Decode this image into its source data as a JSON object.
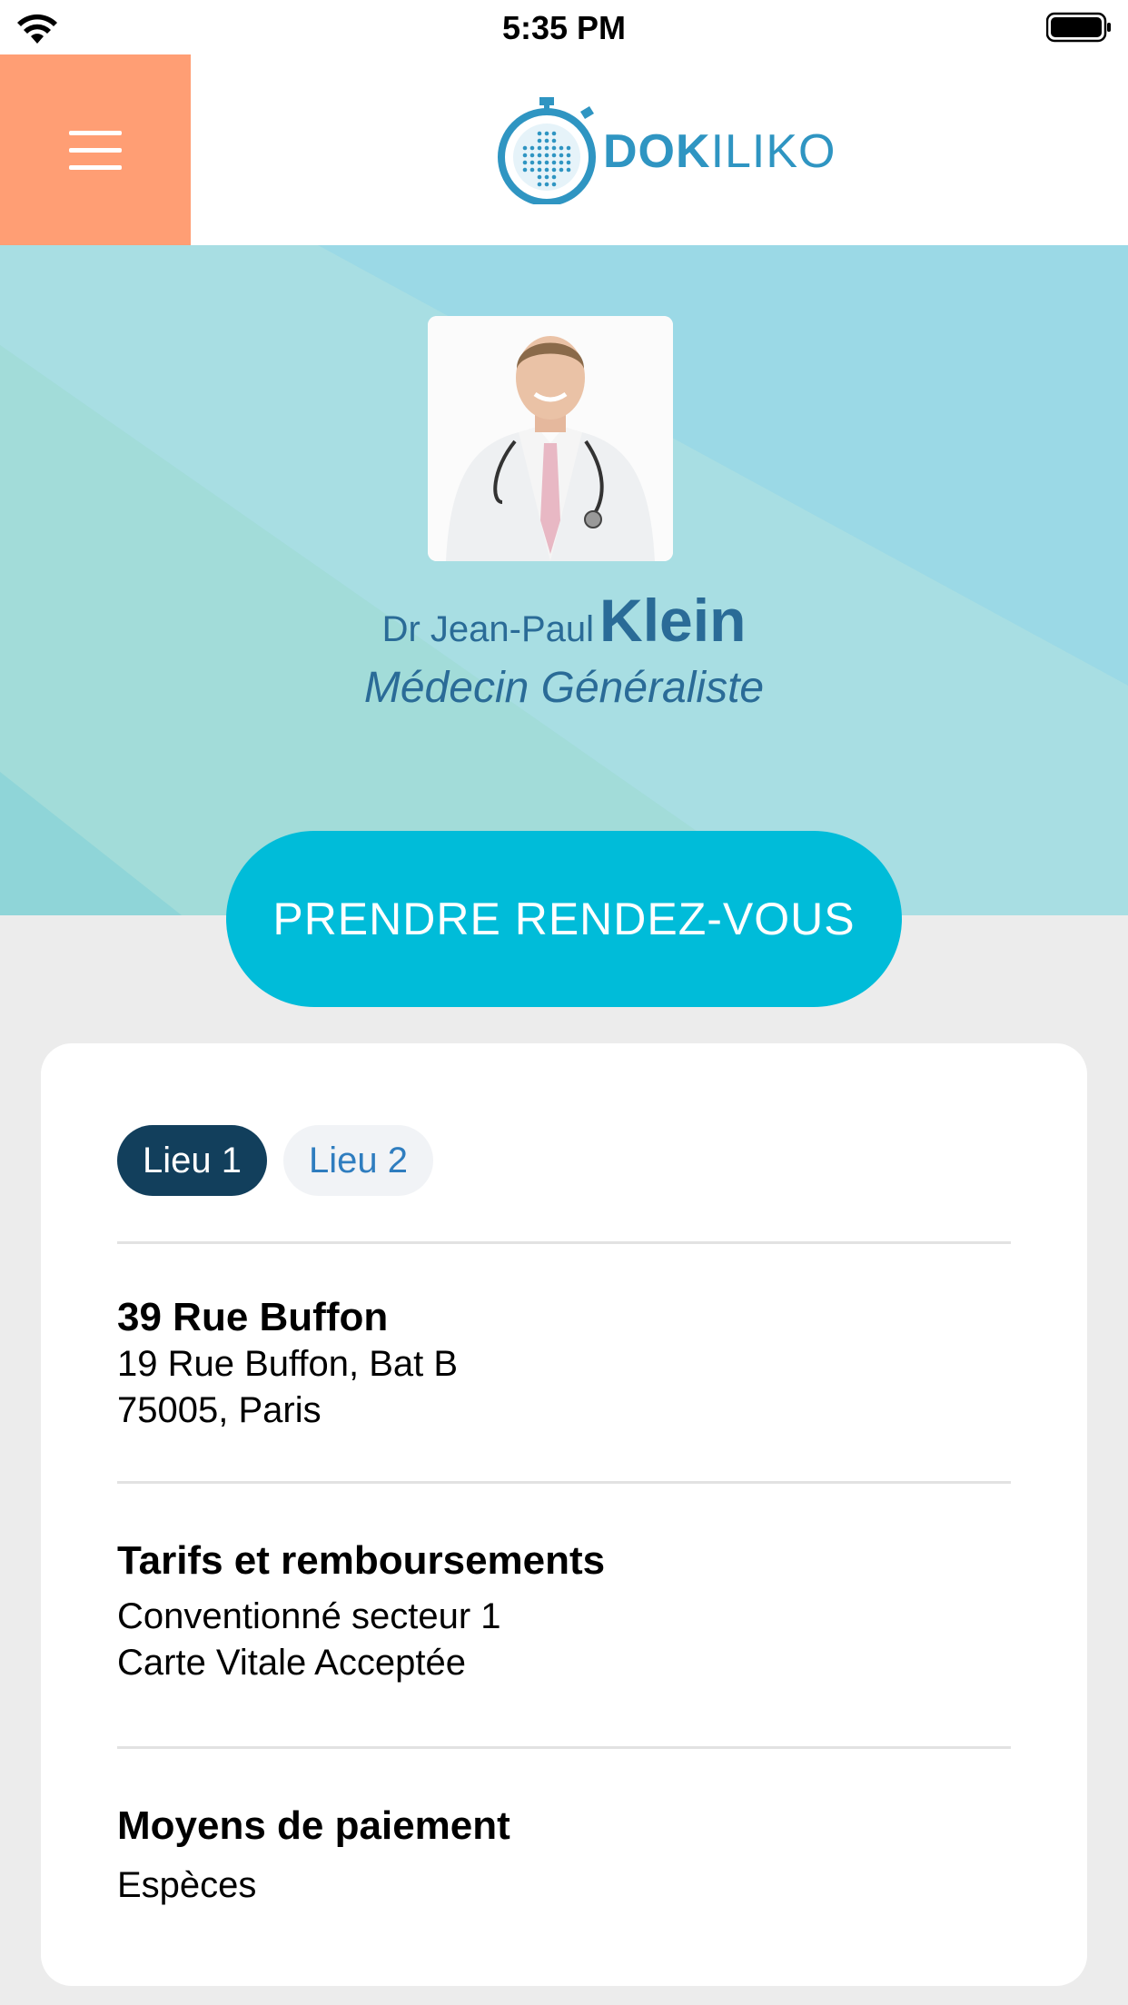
{
  "status_bar": {
    "time": "5:35 PM"
  },
  "header": {
    "logo": {
      "text_bold": "DOK",
      "text_light": "ILIKO"
    },
    "menu_icon": "hamburger-icon"
  },
  "doctor": {
    "title_first": "Dr Jean-Paul",
    "last_name": "Klein",
    "specialty": "Médecin Généraliste"
  },
  "cta": {
    "label": "PRENDRE RENDEZ-VOUS"
  },
  "tabs": [
    {
      "label": "Lieu 1",
      "active": true
    },
    {
      "label": "Lieu 2",
      "active": false
    }
  ],
  "location": {
    "title": "39 Rue Buffon",
    "line1": "19 Rue Buffon, Bat B",
    "line2": "75005, Paris"
  },
  "pricing": {
    "title": "Tarifs et remboursements",
    "line1": "Conventionné secteur 1",
    "line2": "Carte Vitale Acceptée"
  },
  "payment": {
    "title": "Moyens de paiement",
    "line1": "Espèces"
  },
  "colors": {
    "menu_bg": "#ff9e74",
    "cta_bg": "#00bcd9",
    "tab_active_bg": "#123f5c",
    "doctor_text": "#2a6b97",
    "logo": "#2f95c2"
  }
}
